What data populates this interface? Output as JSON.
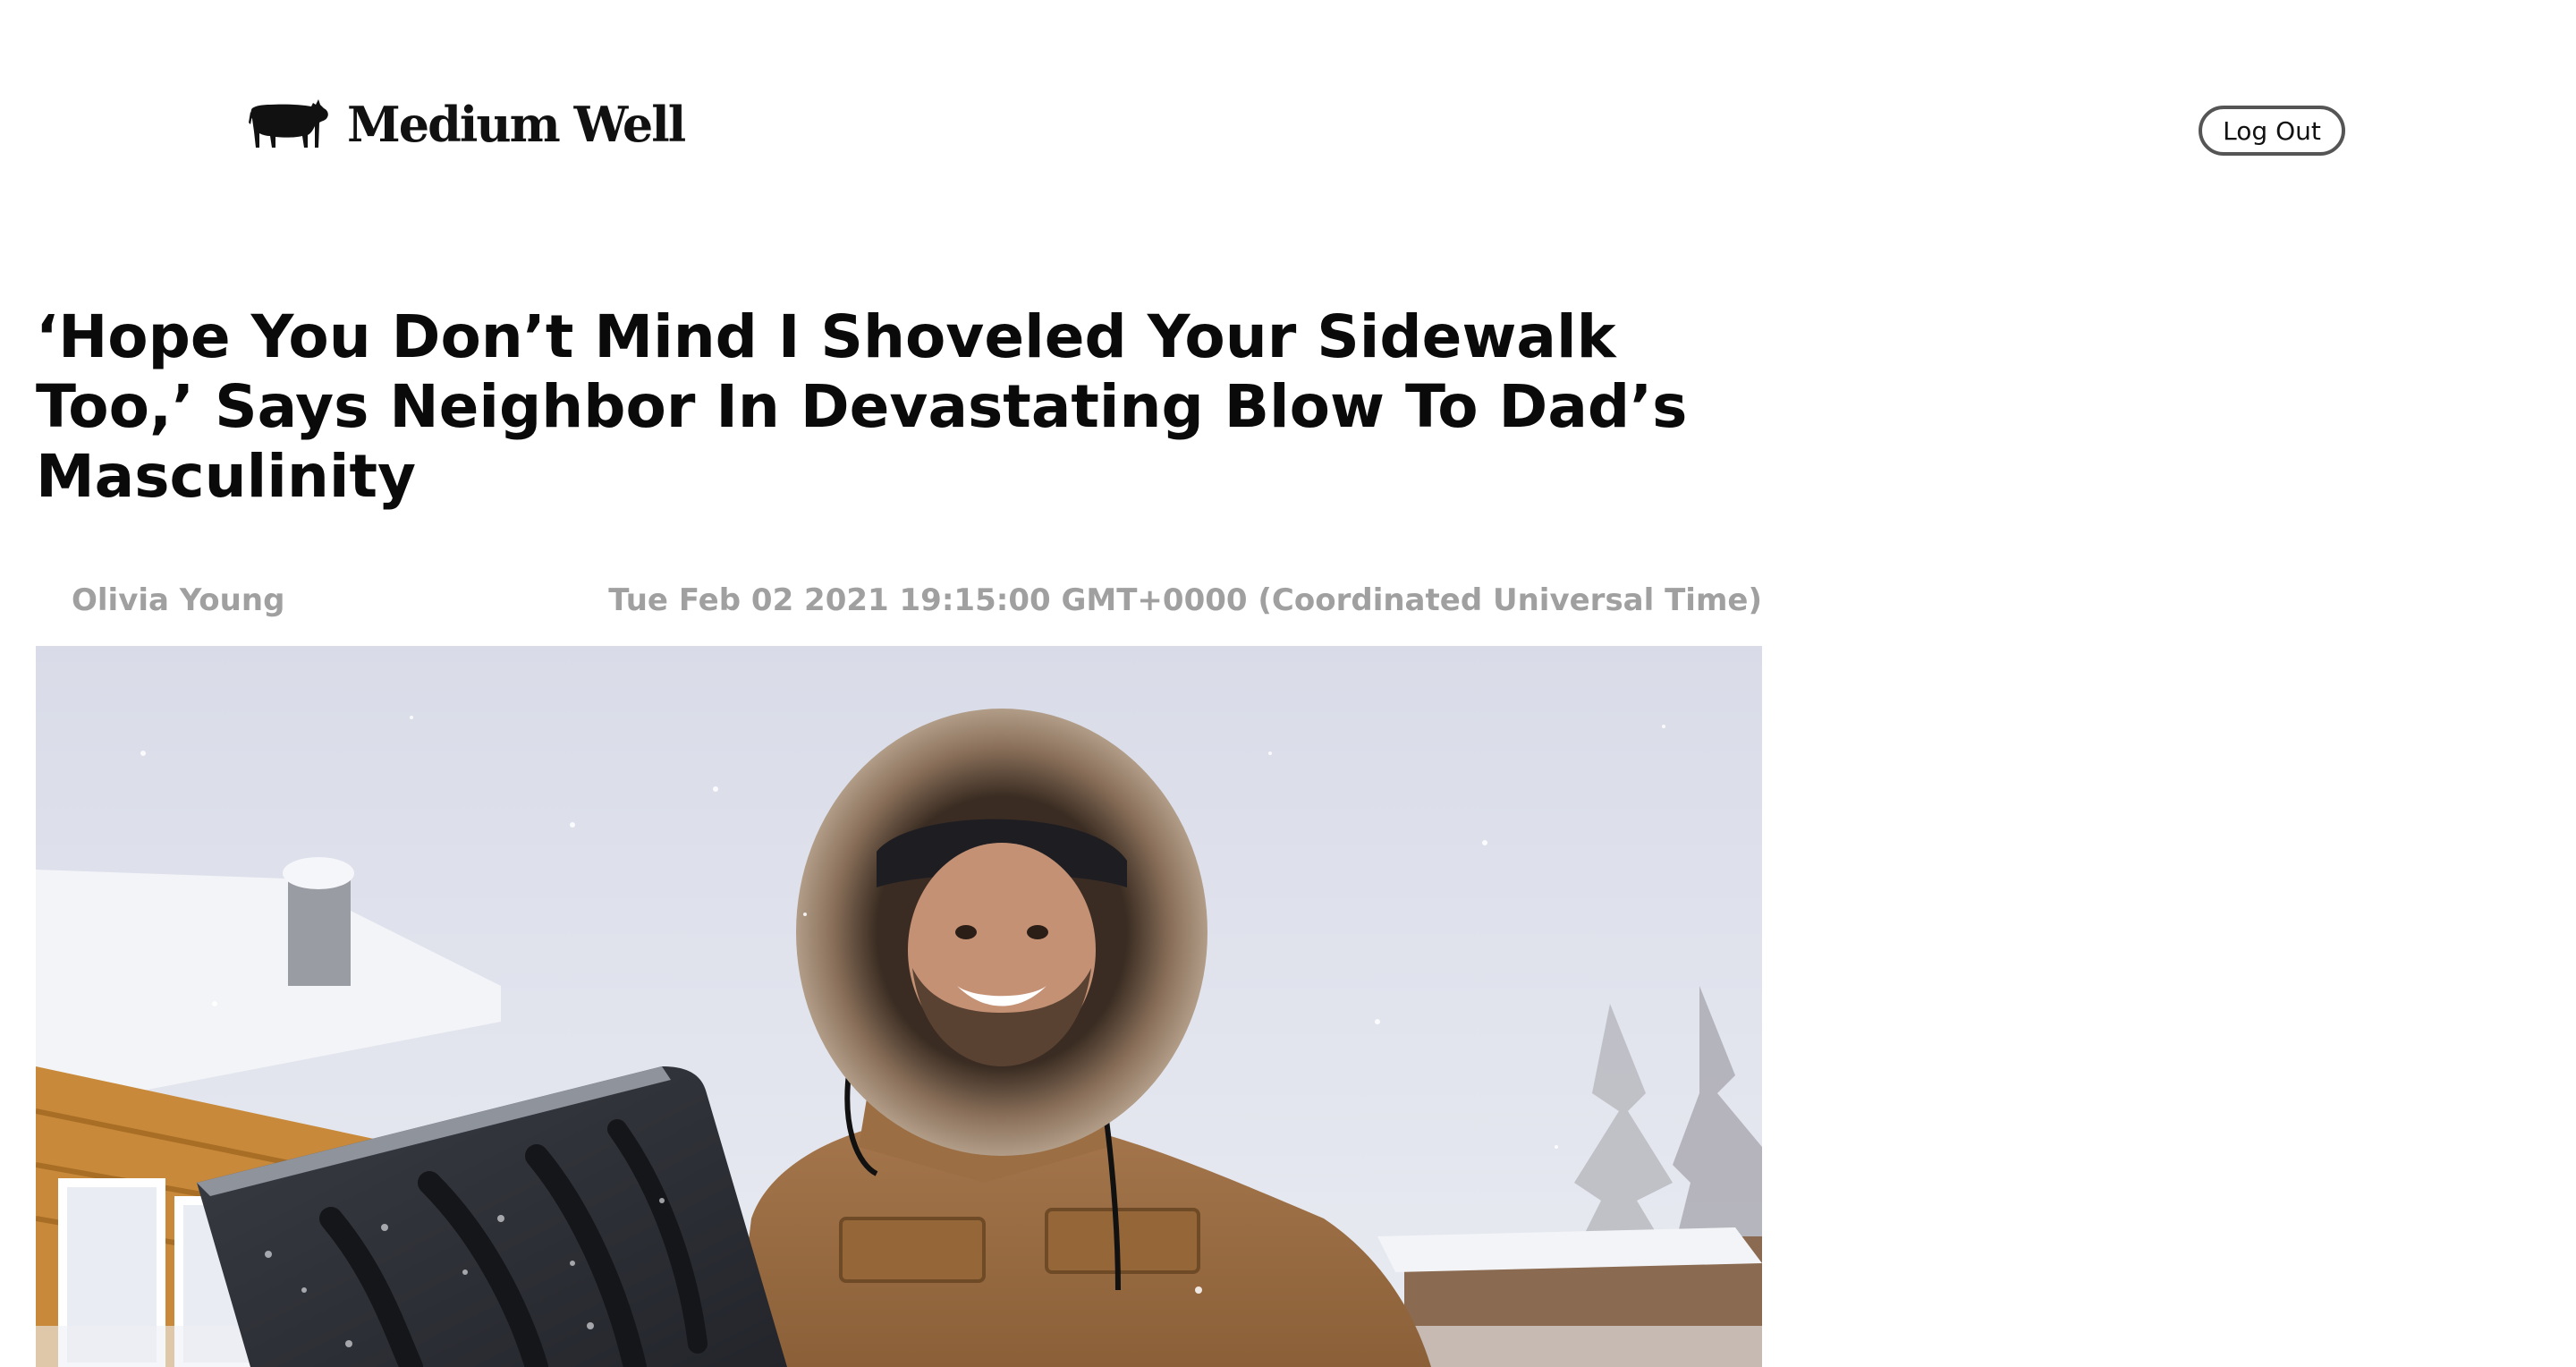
{
  "header": {
    "brand_name": "Medium Well",
    "logo_icon": "cow-icon",
    "logout_label": "Log Out"
  },
  "article": {
    "headline": "‘Hope You Don’t Mind I Shoveled Your Sidewalk Too,’ Says Neighbor In Devastating Blow To Dad’s Masculinity",
    "author": "Olivia Young",
    "date": "Tue Feb 02 2021 19:15:00 GMT+0000 (Coordinated Universal Time)",
    "hero_image": "man-in-fur-hood-with-snow-shovel"
  },
  "colors": {
    "text": "#0a0a0a",
    "byline": "#a0a0a0",
    "button_border": "#555555",
    "background": "#ffffff"
  }
}
